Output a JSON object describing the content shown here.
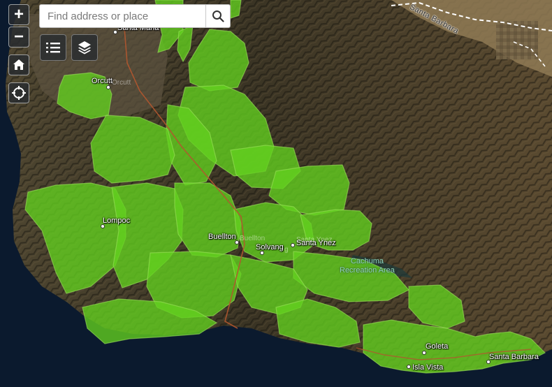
{
  "search": {
    "placeholder": "Find address or place"
  },
  "controls": {
    "zoom_in": "+",
    "zoom_out": "−",
    "home_icon": "home-icon",
    "locate_icon": "locate-icon",
    "legend_icon": "list-icon",
    "layers_icon": "layers-icon",
    "search_icon": "search-icon"
  },
  "colors": {
    "water": "#0b1a2e",
    "land": "#4a3f2c",
    "mountains": "#2c2a1d",
    "overlay": "#63d11f",
    "overlay_edge": "#8ee04a"
  },
  "labels": {
    "orcutt": "Orcutt",
    "orcutt_faint": "Orcutt",
    "santa_maria": "Santa Maria",
    "lompoc": "Lompoc",
    "buellton": "Buellton",
    "buellton_faint": "Buellton",
    "solvang": "Solvang",
    "santa_ynez": "Santa Ynez",
    "santa_ynez_faint": "Santa Ynez",
    "solvang_faint": "g",
    "cachuma_line1": "Cachuma",
    "cachuma_line2": "Recreation Area",
    "goleta": "Goleta",
    "isla_vista": "Isla Vista",
    "santa_barbara": "Santa Barbara",
    "county_line": "Santa Barbara"
  }
}
